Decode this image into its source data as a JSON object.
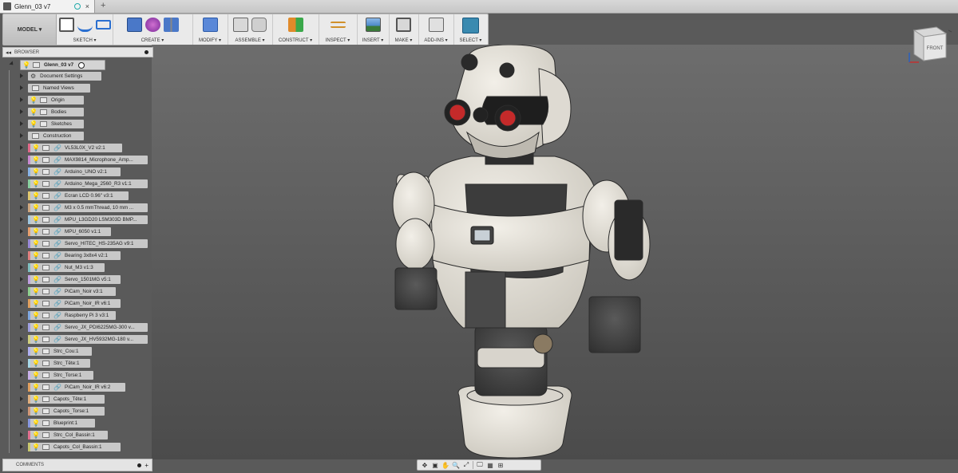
{
  "tab": {
    "title": "Glenn_03 v7",
    "close": "×",
    "new_tab": "+"
  },
  "toolbar": {
    "workspace": "MODEL ▾",
    "groups": [
      {
        "label": "SKETCH ▾"
      },
      {
        "label": "CREATE ▾"
      },
      {
        "label": "MODIFY ▾"
      },
      {
        "label": "ASSEMBLE ▾"
      },
      {
        "label": "CONSTRUCT ▾"
      },
      {
        "label": "INSPECT ▾"
      },
      {
        "label": "INSERT ▾"
      },
      {
        "label": "MAKE ▾"
      },
      {
        "label": "ADD-INS ▾"
      },
      {
        "label": "SELECT ▾"
      }
    ]
  },
  "browser": {
    "title": "BROWSER",
    "collapse": "◂◂",
    "root": "Glenn_03 v7",
    "items": [
      {
        "label": "Document Settings",
        "type": "settings"
      },
      {
        "label": "Named Views",
        "type": "folder"
      },
      {
        "label": "Origin",
        "type": "folder-bulb"
      },
      {
        "label": "Bodies",
        "type": "folder-bulb"
      },
      {
        "label": "Sketches",
        "type": "folder-bulb"
      },
      {
        "label": "Construction",
        "type": "folder"
      },
      {
        "label": "VL53L0X_V2 v2:1",
        "type": "link",
        "color": "#e06a8a"
      },
      {
        "label": "MAX9814_Microphone_Amp...",
        "type": "link",
        "color": "#c98ad0"
      },
      {
        "label": "Arduino_UNO v2:1",
        "type": "link",
        "color": "#8ab4e6"
      },
      {
        "label": "Arduino_Mega_2560_R3 v1:1",
        "type": "link",
        "color": "#8ad0a0"
      },
      {
        "label": "Ecran LCD 0.96\" v3:1",
        "type": "link",
        "color": "#e0c870"
      },
      {
        "label": "M3 x 0.5 mmThread, 10 mm ...",
        "type": "link",
        "color": "#d0a880"
      },
      {
        "label": "MPU_L3GD20 LSM303D BMP...",
        "type": "link",
        "color": "#a0c8e0"
      },
      {
        "label": "MPU_6050 v1:1",
        "type": "link",
        "color": "#e6a070"
      },
      {
        "label": "Servo_HITEC_HS-235AG v9:1",
        "type": "link-multi",
        "color": "#9a8ad8"
      },
      {
        "label": "Bearing 3x8x4 v2:1",
        "type": "link",
        "color": "#e08080"
      },
      {
        "label": "Nut_M3 v1:3",
        "type": "link",
        "color": "#80c0c0"
      },
      {
        "label": "Servo_1501MG v5:1",
        "type": "link-multi",
        "color": "#c0a0e0"
      },
      {
        "label": "PiCam_Noir v3:1",
        "type": "link",
        "color": "#90d090"
      },
      {
        "label": "PiCam_Noir_IR v6:1",
        "type": "link",
        "color": "#e0a060"
      },
      {
        "label": "Raspberry Pi 3 v3:1",
        "type": "link",
        "color": "#80a8e0"
      },
      {
        "label": "Servo_JX_PDI6225MG-300 v...",
        "type": "link-multi",
        "color": "#a0a0e0"
      },
      {
        "label": "Servo_JX_HV5932MG-180 v...",
        "type": "link-multi",
        "color": "#d0d080"
      },
      {
        "label": "Strc_Cou:1",
        "type": "plain",
        "color": "#b0b0f0"
      },
      {
        "label": "Strc_Tête:1",
        "type": "plain",
        "color": "#a8d8e8"
      },
      {
        "label": "Strc_Torse:1",
        "type": "plain",
        "color": "#c8b0e8"
      },
      {
        "label": "PiCam_Noir_IR v6:2",
        "type": "link",
        "color": "#e0a060"
      },
      {
        "label": "Capots_Tête:1",
        "type": "plain",
        "color": "#e0b080"
      },
      {
        "label": "Capots_Torse:1",
        "type": "plain",
        "color": "#d09878"
      },
      {
        "label": "Blueprint:1",
        "type": "plain",
        "color": "#8898e0"
      },
      {
        "label": "Strc_Col_Bassin:1",
        "type": "plain",
        "color": "#e07090"
      },
      {
        "label": "Capots_Col_Bassin:1",
        "type": "plain",
        "color": "#c8c870"
      }
    ]
  },
  "comments": {
    "title": "COMMENTS",
    "add": "+"
  },
  "viewcube": {
    "face": "FRONT"
  },
  "navbar": {
    "icons": [
      "orbit-icon",
      "look-at-icon",
      "pan-icon",
      "zoom-icon",
      "fit-icon",
      "display-settings-icon",
      "grid-icon",
      "viewports-icon"
    ],
    "glyphs": [
      "✥",
      "▣",
      "✋",
      "🔍",
      "⤢",
      "🖵",
      "▦",
      "⊞"
    ]
  },
  "colors": {
    "viewport_top": "#6b6b6b",
    "viewport_bottom": "#4a4a4a",
    "robot_shell": "#e6e2da",
    "eye_red": "#c42a2a"
  }
}
